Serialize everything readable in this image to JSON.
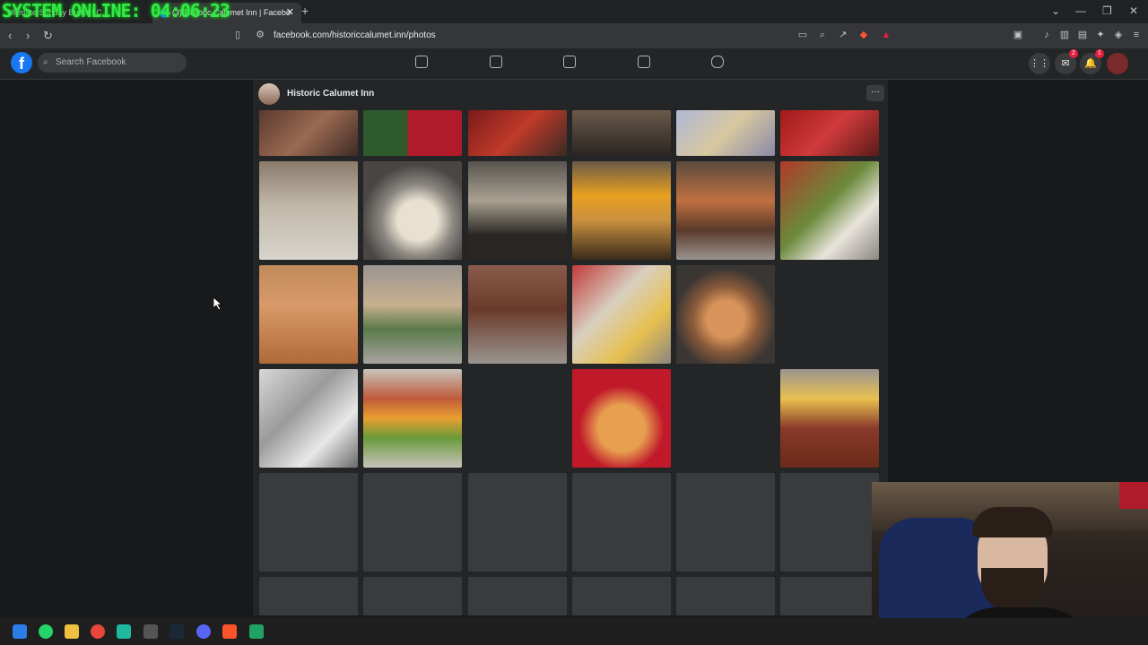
{
  "overlay": {
    "text": "SYSTEM ONLINE: 04:06:23"
  },
  "browser": {
    "tabs": [
      {
        "label": "Ultimate Sunday Buffet | C..."
      },
      {
        "label": "(3) Historic Calumet Inn | Facebo"
      }
    ],
    "new_tab": "+",
    "url": "facebook.com/historiccalumet.inn/photos"
  },
  "facebook": {
    "search_placeholder": "Search Facebook",
    "messenger_badge": "2",
    "notification_badge": "1",
    "page_name": "Historic Calumet Inn",
    "more_label": "···"
  },
  "photos": {
    "row1": [
      "buffet-meat",
      "christmas-sign",
      "buffet-tray",
      "buffet-tray",
      "cookies",
      "candy-bowl"
    ],
    "row2": [
      "salad-bar",
      "tortillas",
      "toppings",
      "nacho-cheese",
      "rice-meat",
      "salsa-guac"
    ],
    "row3": [
      "spanish-rice",
      "buffet-line",
      "meats",
      "cauliflower-cheese",
      "rolls"
    ],
    "row4": [
      "foil-potatoes",
      "veggie-tray",
      "",
      "dinner-rolls",
      "",
      "chicken"
    ]
  },
  "colors": {
    "accent": "#1877f2",
    "overlay_green": "#37e64d",
    "badge": "#e41e3f"
  }
}
